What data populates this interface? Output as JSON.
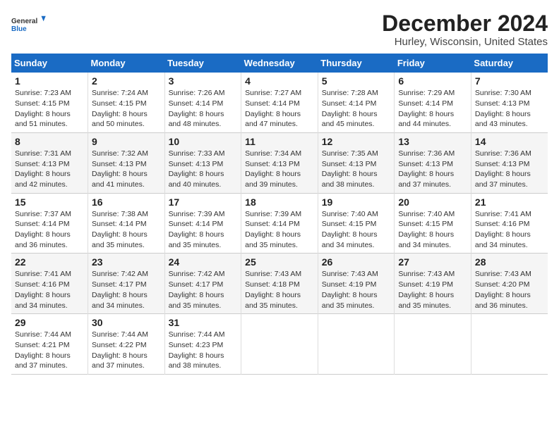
{
  "logo": {
    "line1": "General",
    "line2": "Blue"
  },
  "title": "December 2024",
  "subtitle": "Hurley, Wisconsin, United States",
  "days_header": [
    "Sunday",
    "Monday",
    "Tuesday",
    "Wednesday",
    "Thursday",
    "Friday",
    "Saturday"
  ],
  "weeks": [
    [
      {
        "day": "1",
        "rise": "Sunrise: 7:23 AM",
        "set": "Sunset: 4:15 PM",
        "daylight": "Daylight: 8 hours and 51 minutes."
      },
      {
        "day": "2",
        "rise": "Sunrise: 7:24 AM",
        "set": "Sunset: 4:15 PM",
        "daylight": "Daylight: 8 hours and 50 minutes."
      },
      {
        "day": "3",
        "rise": "Sunrise: 7:26 AM",
        "set": "Sunset: 4:14 PM",
        "daylight": "Daylight: 8 hours and 48 minutes."
      },
      {
        "day": "4",
        "rise": "Sunrise: 7:27 AM",
        "set": "Sunset: 4:14 PM",
        "daylight": "Daylight: 8 hours and 47 minutes."
      },
      {
        "day": "5",
        "rise": "Sunrise: 7:28 AM",
        "set": "Sunset: 4:14 PM",
        "daylight": "Daylight: 8 hours and 45 minutes."
      },
      {
        "day": "6",
        "rise": "Sunrise: 7:29 AM",
        "set": "Sunset: 4:14 PM",
        "daylight": "Daylight: 8 hours and 44 minutes."
      },
      {
        "day": "7",
        "rise": "Sunrise: 7:30 AM",
        "set": "Sunset: 4:13 PM",
        "daylight": "Daylight: 8 hours and 43 minutes."
      }
    ],
    [
      {
        "day": "8",
        "rise": "Sunrise: 7:31 AM",
        "set": "Sunset: 4:13 PM",
        "daylight": "Daylight: 8 hours and 42 minutes."
      },
      {
        "day": "9",
        "rise": "Sunrise: 7:32 AM",
        "set": "Sunset: 4:13 PM",
        "daylight": "Daylight: 8 hours and 41 minutes."
      },
      {
        "day": "10",
        "rise": "Sunrise: 7:33 AM",
        "set": "Sunset: 4:13 PM",
        "daylight": "Daylight: 8 hours and 40 minutes."
      },
      {
        "day": "11",
        "rise": "Sunrise: 7:34 AM",
        "set": "Sunset: 4:13 PM",
        "daylight": "Daylight: 8 hours and 39 minutes."
      },
      {
        "day": "12",
        "rise": "Sunrise: 7:35 AM",
        "set": "Sunset: 4:13 PM",
        "daylight": "Daylight: 8 hours and 38 minutes."
      },
      {
        "day": "13",
        "rise": "Sunrise: 7:36 AM",
        "set": "Sunset: 4:13 PM",
        "daylight": "Daylight: 8 hours and 37 minutes."
      },
      {
        "day": "14",
        "rise": "Sunrise: 7:36 AM",
        "set": "Sunset: 4:13 PM",
        "daylight": "Daylight: 8 hours and 37 minutes."
      }
    ],
    [
      {
        "day": "15",
        "rise": "Sunrise: 7:37 AM",
        "set": "Sunset: 4:14 PM",
        "daylight": "Daylight: 8 hours and 36 minutes."
      },
      {
        "day": "16",
        "rise": "Sunrise: 7:38 AM",
        "set": "Sunset: 4:14 PM",
        "daylight": "Daylight: 8 hours and 35 minutes."
      },
      {
        "day": "17",
        "rise": "Sunrise: 7:39 AM",
        "set": "Sunset: 4:14 PM",
        "daylight": "Daylight: 8 hours and 35 minutes."
      },
      {
        "day": "18",
        "rise": "Sunrise: 7:39 AM",
        "set": "Sunset: 4:14 PM",
        "daylight": "Daylight: 8 hours and 35 minutes."
      },
      {
        "day": "19",
        "rise": "Sunrise: 7:40 AM",
        "set": "Sunset: 4:15 PM",
        "daylight": "Daylight: 8 hours and 34 minutes."
      },
      {
        "day": "20",
        "rise": "Sunrise: 7:40 AM",
        "set": "Sunset: 4:15 PM",
        "daylight": "Daylight: 8 hours and 34 minutes."
      },
      {
        "day": "21",
        "rise": "Sunrise: 7:41 AM",
        "set": "Sunset: 4:16 PM",
        "daylight": "Daylight: 8 hours and 34 minutes."
      }
    ],
    [
      {
        "day": "22",
        "rise": "Sunrise: 7:41 AM",
        "set": "Sunset: 4:16 PM",
        "daylight": "Daylight: 8 hours and 34 minutes."
      },
      {
        "day": "23",
        "rise": "Sunrise: 7:42 AM",
        "set": "Sunset: 4:17 PM",
        "daylight": "Daylight: 8 hours and 34 minutes."
      },
      {
        "day": "24",
        "rise": "Sunrise: 7:42 AM",
        "set": "Sunset: 4:17 PM",
        "daylight": "Daylight: 8 hours and 35 minutes."
      },
      {
        "day": "25",
        "rise": "Sunrise: 7:43 AM",
        "set": "Sunset: 4:18 PM",
        "daylight": "Daylight: 8 hours and 35 minutes."
      },
      {
        "day": "26",
        "rise": "Sunrise: 7:43 AM",
        "set": "Sunset: 4:19 PM",
        "daylight": "Daylight: 8 hours and 35 minutes."
      },
      {
        "day": "27",
        "rise": "Sunrise: 7:43 AM",
        "set": "Sunset: 4:19 PM",
        "daylight": "Daylight: 8 hours and 35 minutes."
      },
      {
        "day": "28",
        "rise": "Sunrise: 7:43 AM",
        "set": "Sunset: 4:20 PM",
        "daylight": "Daylight: 8 hours and 36 minutes."
      }
    ],
    [
      {
        "day": "29",
        "rise": "Sunrise: 7:44 AM",
        "set": "Sunset: 4:21 PM",
        "daylight": "Daylight: 8 hours and 37 minutes."
      },
      {
        "day": "30",
        "rise": "Sunrise: 7:44 AM",
        "set": "Sunset: 4:22 PM",
        "daylight": "Daylight: 8 hours and 37 minutes."
      },
      {
        "day": "31",
        "rise": "Sunrise: 7:44 AM",
        "set": "Sunset: 4:23 PM",
        "daylight": "Daylight: 8 hours and 38 minutes."
      },
      {
        "day": "",
        "rise": "",
        "set": "",
        "daylight": ""
      },
      {
        "day": "",
        "rise": "",
        "set": "",
        "daylight": ""
      },
      {
        "day": "",
        "rise": "",
        "set": "",
        "daylight": ""
      },
      {
        "day": "",
        "rise": "",
        "set": "",
        "daylight": ""
      }
    ]
  ]
}
